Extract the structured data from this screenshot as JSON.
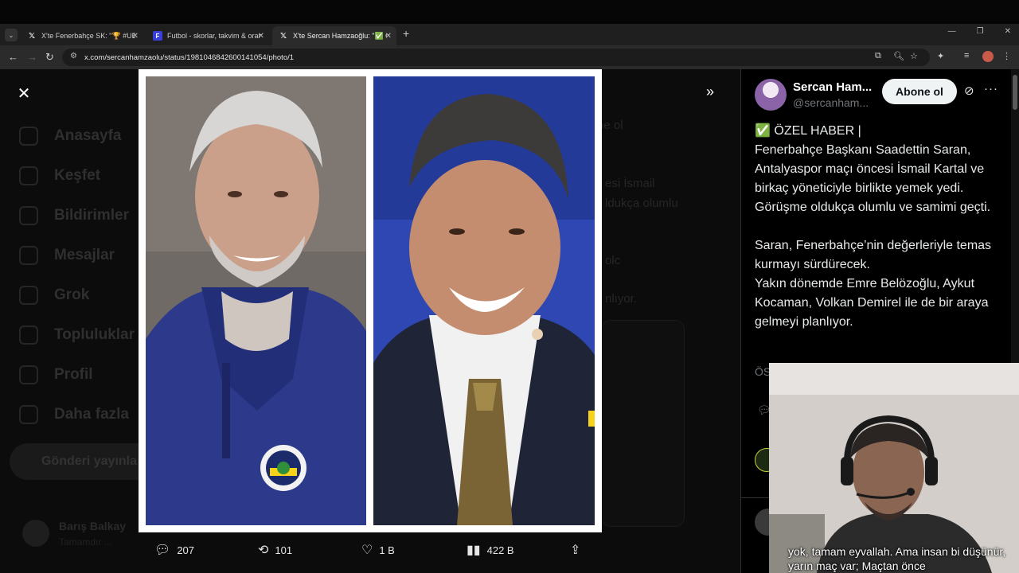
{
  "browser": {
    "tabs": [
      {
        "favicon": "x-logo-icon",
        "title": "X'te Fenerbahçe SK: \"🏆 #UEL",
        "active": false
      },
      {
        "favicon": "flashscore-icon",
        "title": "Futbol - skorlar, takvim & oran",
        "active": false
      },
      {
        "favicon": "x-logo-icon",
        "title": "X'te Sercan Hamzaoğlu: \"✅ ÖZ",
        "active": true
      }
    ],
    "url": "x.com/sercanhamzaolu/status/1981046842600141054/photo/1"
  },
  "background": {
    "nav": [
      "Anasayfa",
      "Keşfet",
      "Bildirimler",
      "Mesajlar",
      "Grok",
      "Topluluklar",
      "Profil",
      "Daha fazla"
    ],
    "post_button": "Gönderi yayınla",
    "account_name": "Barış Balkay",
    "account_handle": "Tamamdır ...",
    "snippets": [
      "ne ol",
      "esi İsmail",
      "ldukça olumlu",
      "olc",
      "nlıyor."
    ]
  },
  "photo_actions": {
    "replies": "207",
    "reposts": "101",
    "likes": "1 B",
    "views": "422 B"
  },
  "post": {
    "display_name": "Sercan Ham...",
    "handle": "@sercanham...",
    "follow_label": "Abone ol",
    "text": "✅ ÖZEL HABER |\nFenerbahçe Başkanı Saadettin Saran, Antalyaspor maçı öncesi İsmail Kartal ve birkaç yöneticiyle birlikte yemek yedi. Görüşme oldukça olumlu ve samimi geçti.\n\nSaran, Fenerbahçe’nin değerleriyle temas kurmayı sürdürecek.\nYakın dönemde Emre Belözoğlu, Aykut Kocaman, Volkan Demirel ile de bir araya gelmeyi planlıyor.",
    "truncated_label": "ÖS"
  },
  "overlay": {
    "subtitle": "yok, tamam eyvallah. Ama insan bi düşünür, yarın maç var;  Maçtan önce"
  },
  "colors": {
    "x_bg": "#000000",
    "text": "#e7e9ea",
    "muted": "#71767b",
    "follow_bg": "#eff3f4",
    "fb_blue": "#1b2a6b",
    "fb_yellow": "#f6d21a"
  }
}
